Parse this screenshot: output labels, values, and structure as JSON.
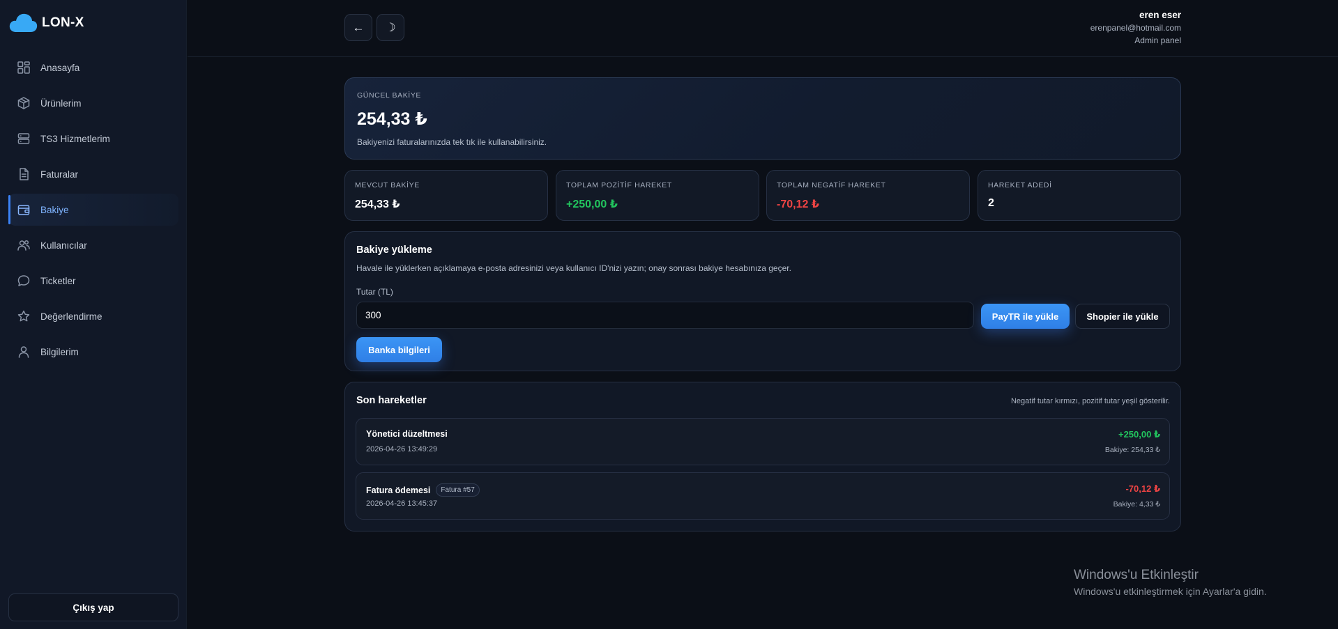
{
  "brand": {
    "name": "LON-X",
    "accent": "#38a9f5"
  },
  "sidebar": {
    "items": [
      {
        "label": "Anasayfa",
        "icon": "dashboard-grid-icon",
        "active": false
      },
      {
        "label": "Ürünlerim",
        "icon": "box-icon",
        "active": false
      },
      {
        "label": "TS3 Hizmetlerim",
        "icon": "server-icon",
        "active": false
      },
      {
        "label": "Faturalar",
        "icon": "document-icon",
        "active": false
      },
      {
        "label": "Bakiye",
        "icon": "wallet-icon",
        "active": true
      },
      {
        "label": "Kullanıcılar",
        "icon": "users-icon",
        "active": false
      },
      {
        "label": "Ticketler",
        "icon": "chat-bubble-icon",
        "active": false
      },
      {
        "label": "Değerlendirme",
        "icon": "star-icon",
        "active": false
      },
      {
        "label": "Bilgilerim",
        "icon": "user-icon",
        "active": false
      }
    ],
    "logout_label": "Çıkış yap"
  },
  "topbar": {
    "back_glyph": "←",
    "theme_glyph": "☽",
    "user": {
      "name": "eren eser",
      "email": "erenpanel@hotmail.com",
      "role": "Admin panel"
    }
  },
  "balance": {
    "label": "GÜNCEL BAKİYE",
    "amount": "254,33 ₺",
    "note": "Bakiyenizi faturalarınızda tek tık ile kullanabilirsiniz."
  },
  "stats": [
    {
      "label": "MEVCUT BAKİYE",
      "value": "254,33 ₺",
      "tone": "neutral"
    },
    {
      "label": "TOPLAM POZİTİF HAREKET",
      "value": "+250,00 ₺",
      "tone": "positive"
    },
    {
      "label": "TOPLAM NEGATİF HAREKET",
      "value": "-70,12 ₺",
      "tone": "negative"
    },
    {
      "label": "HAREKET ADEDİ",
      "value": "2",
      "tone": "neutral"
    }
  ],
  "topup": {
    "title": "Bakiye yükleme",
    "description": "Havale ile yüklerken açıklamaya e-posta adresinizi veya kullanıcı ID'nizi yazın; onay sonrası bakiye hesabınıza geçer.",
    "amount_label": "Tutar (TL)",
    "amount_value": "300",
    "paytr_label": "PayTR ile yükle",
    "shopier_label": "Shopier ile yükle",
    "bank_label": "Banka bilgileri"
  },
  "recent": {
    "title": "Son hareketler",
    "note": "Negatif tutar kırmızı, pozitif tutar yeşil gösterilir.",
    "items": [
      {
        "title": "Yönetici düzeltmesi",
        "badge": "",
        "date": "2026-04-26 13:49:29",
        "amount": "+250,00 ₺",
        "balance": "Bakiye: 254,33 ₺",
        "tone": "positive"
      },
      {
        "title": "Fatura ödemesi",
        "badge": "Fatura #57",
        "date": "2026-04-26 13:45:37",
        "amount": "-70,12 ₺",
        "balance": "Bakiye: 4,33 ₺",
        "tone": "negative"
      }
    ]
  },
  "watermark": {
    "title": "Windows'u Etkinleştir",
    "subtitle": "Windows'u etkinleştirmek için Ayarlar'a gidin."
  },
  "colors": {
    "positive": "#22c55e",
    "negative": "#ef4444",
    "primary": "#3b8ff0"
  }
}
